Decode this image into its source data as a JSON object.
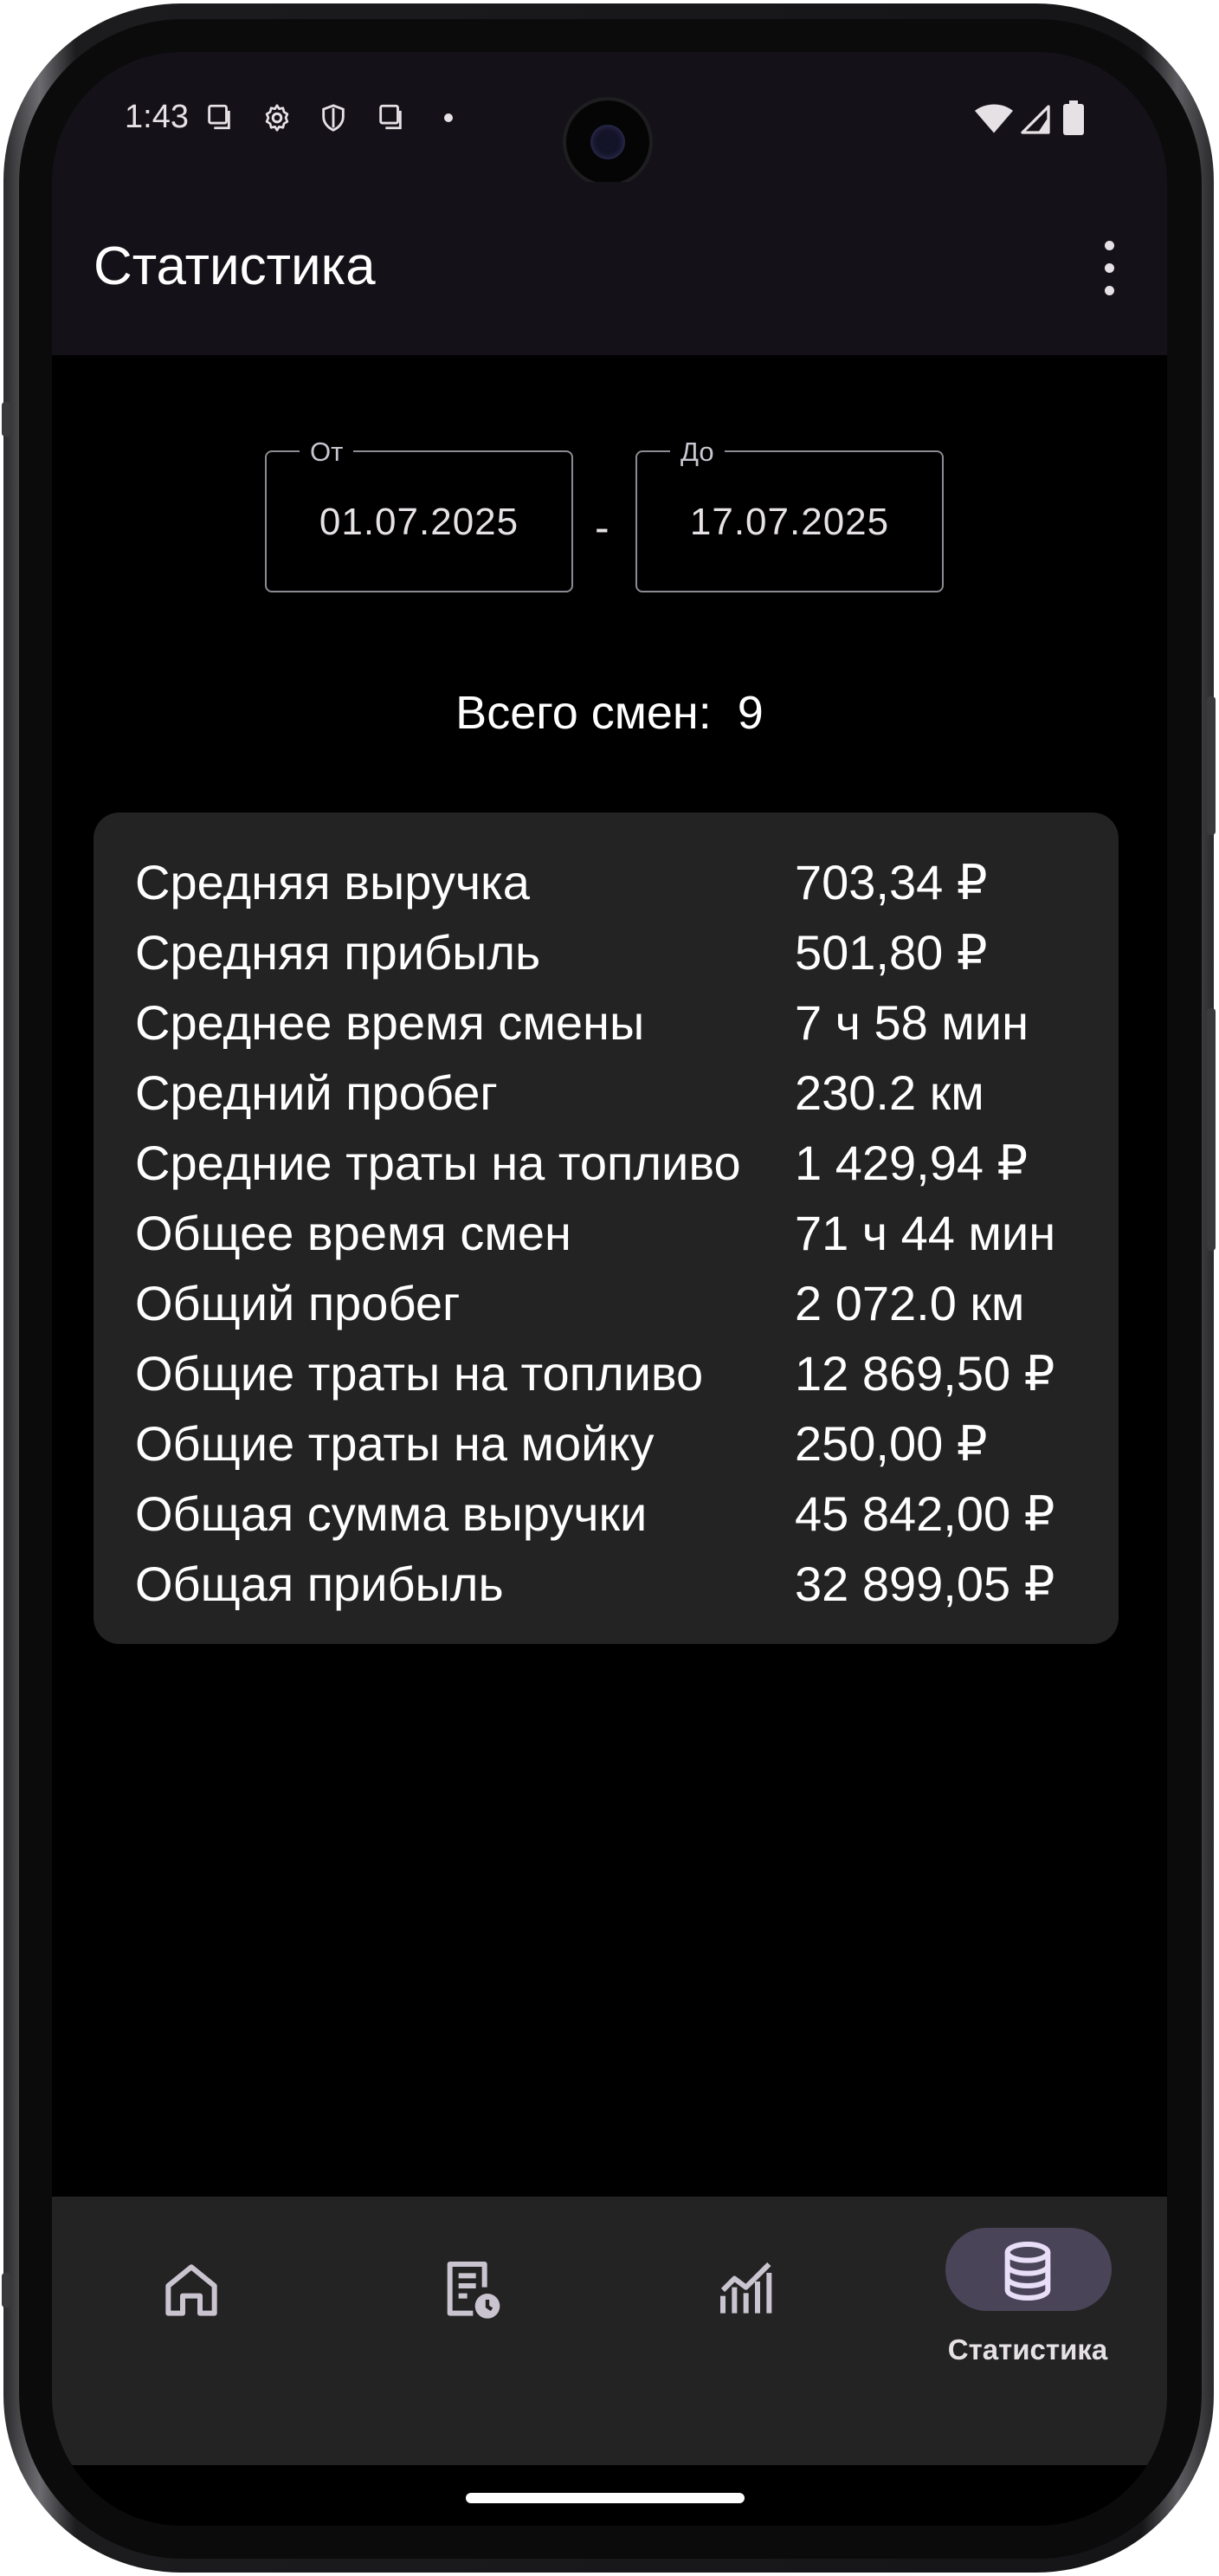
{
  "status_bar": {
    "time": "1:43",
    "left_icons": [
      "sim-card-icon",
      "settings-icon",
      "shield-icon",
      "copy-icon",
      "dot-icon"
    ],
    "right_icons": [
      "wifi-icon",
      "signal-icon",
      "battery-icon"
    ]
  },
  "app_bar": {
    "title": "Статистика",
    "menu_icon": "more-vert-icon"
  },
  "date_range": {
    "from_label": "От",
    "from_value": "01.07.2025",
    "separator": "-",
    "to_label": "До",
    "to_value": "17.07.2025"
  },
  "summary": {
    "total_shifts_label": "Всего смен:",
    "total_shifts_value": "9"
  },
  "stats": [
    {
      "label": "Средняя выручка",
      "value": "703,34 ₽"
    },
    {
      "label": "Средняя прибыль",
      "value": "501,80 ₽"
    },
    {
      "label": "Среднее время смены",
      "value": "7 ч 58 мин"
    },
    {
      "label": "Средний пробег",
      "value": "230.2 км"
    },
    {
      "label": "Средние траты на топливо",
      "value": "1 429,94 ₽"
    },
    {
      "label": "Общее время смен",
      "value": "71 ч 44 мин"
    },
    {
      "label": "Общий пробег",
      "value": "2 072.0 км"
    },
    {
      "label": "Общие траты на топливо",
      "value": "12 869,50 ₽"
    },
    {
      "label": "Общие траты на мойку",
      "value": "250,00 ₽"
    },
    {
      "label": "Общая сумма выручки",
      "value": "45 842,00 ₽"
    },
    {
      "label": "Общая прибыль",
      "value": "32 899,05 ₽"
    }
  ],
  "bottom_nav": {
    "items": [
      {
        "icon": "home-icon",
        "label": "",
        "selected": false
      },
      {
        "icon": "shift-history-icon",
        "label": "",
        "selected": false
      },
      {
        "icon": "analytics-icon",
        "label": "",
        "selected": false
      },
      {
        "icon": "database-icon",
        "label": "Статистика",
        "selected": true
      }
    ]
  },
  "colors": {
    "background": "#000000",
    "app_bar": "#141218",
    "card": "#232323",
    "nav_indicator": "#4a4458",
    "text": "#ffffff"
  }
}
